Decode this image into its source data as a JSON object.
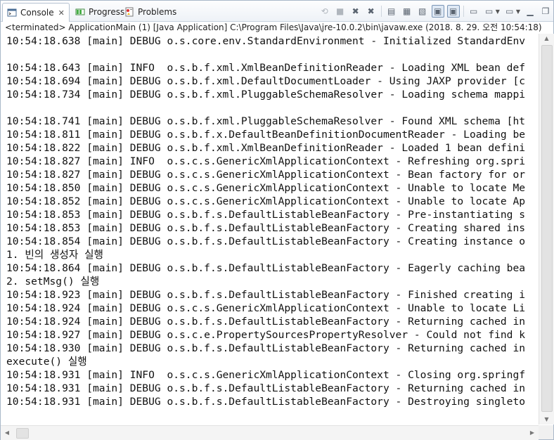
{
  "tabs": [
    {
      "label": "Console",
      "icon": "console-icon",
      "active": true
    },
    {
      "label": "Progress",
      "icon": "progress-icon",
      "active": false
    },
    {
      "label": "Problems",
      "icon": "problems-icon",
      "active": false
    }
  ],
  "console_tab_close": "✕",
  "description": "<terminated> ApplicationMain (1) [Java Application] C:\\Program Files\\Java\\jre-10.0.2\\bin\\javaw.exe (2018. 8. 29. 오전 10:54:18)",
  "toolbar_icons": [
    "terminate-icon",
    "stop-icon",
    "remove-launch-icon",
    "remove-all-terminated-icon",
    "clear-console-icon",
    "scroll-lock-icon",
    "word-wrap-icon",
    "show-on-stdout-icon",
    "show-on-stderr-icon",
    "pin-console-icon",
    "display-selected-console-icon",
    "open-console-icon",
    "minimize-icon",
    "maximize-icon"
  ],
  "lines": [
    "10:54:18.638 [main] DEBUG o.s.core.env.StandardEnvironment - Initialized StandardEnv",
    "",
    "10:54:18.643 [main] INFO  o.s.b.f.xml.XmlBeanDefinitionReader - Loading XML bean def",
    "10:54:18.694 [main] DEBUG o.s.b.f.xml.DefaultDocumentLoader - Using JAXP provider [c",
    "10:54:18.734 [main] DEBUG o.s.b.f.xml.PluggableSchemaResolver - Loading schema mappi",
    "",
    "10:54:18.741 [main] DEBUG o.s.b.f.xml.PluggableSchemaResolver - Found XML schema [ht",
    "10:54:18.811 [main] DEBUG o.s.b.f.x.DefaultBeanDefinitionDocumentReader - Loading be",
    "10:54:18.822 [main] DEBUG o.s.b.f.xml.XmlBeanDefinitionReader - Loaded 1 bean defini",
    "10:54:18.827 [main] INFO  o.s.c.s.GenericXmlApplicationContext - Refreshing org.spri",
    "10:54:18.827 [main] DEBUG o.s.c.s.GenericXmlApplicationContext - Bean factory for or",
    "10:54:18.850 [main] DEBUG o.s.c.s.GenericXmlApplicationContext - Unable to locate Me",
    "10:54:18.852 [main] DEBUG o.s.c.s.GenericXmlApplicationContext - Unable to locate Ap",
    "10:54:18.853 [main] DEBUG o.s.b.f.s.DefaultListableBeanFactory - Pre-instantiating s",
    "10:54:18.853 [main] DEBUG o.s.b.f.s.DefaultListableBeanFactory - Creating shared ins",
    "10:54:18.854 [main] DEBUG o.s.b.f.s.DefaultListableBeanFactory - Creating instance o",
    "1. 빈의 생성자 실행",
    "10:54:18.864 [main] DEBUG o.s.b.f.s.DefaultListableBeanFactory - Eagerly caching bea",
    "2. setMsg() 실행",
    "10:54:18.923 [main] DEBUG o.s.b.f.s.DefaultListableBeanFactory - Finished creating i",
    "10:54:18.924 [main] DEBUG o.s.c.s.GenericXmlApplicationContext - Unable to locate Li",
    "10:54:18.924 [main] DEBUG o.s.b.f.s.DefaultListableBeanFactory - Returning cached in",
    "10:54:18.927 [main] DEBUG o.s.c.e.PropertySourcesPropertyResolver - Could not find k",
    "10:54:18.930 [main] DEBUG o.s.b.f.s.DefaultListableBeanFactory - Returning cached in",
    "execute() 실행",
    "10:54:18.931 [main] INFO  o.s.c.s.GenericXmlApplicationContext - Closing org.springf",
    "10:54:18.931 [main] DEBUG o.s.b.f.s.DefaultListableBeanFactory - Returning cached in",
    "10:54:18.931 [main] DEBUG o.s.b.f.s.DefaultListableBeanFactory - Destroying singleto"
  ]
}
